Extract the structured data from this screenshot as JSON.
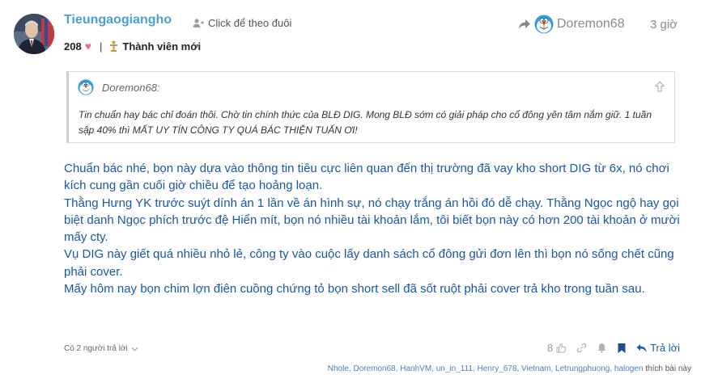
{
  "header": {
    "username": "Tieungaogiangho",
    "follow_label": "Click để theo đuôi",
    "reply_to_user": "Doremon68",
    "time": "3 giờ",
    "points": "208",
    "rank_label": "Thành viên mới"
  },
  "quote": {
    "author": "Doremon68:",
    "text": "Tin chuẩn hay bác chỉ đoán thôi. Chờ tin chính thức của BLĐ DIG. Mong BLĐ sớm có giải pháp cho cổ đông yên tâm nắm giữ. 1 tuần sập 40% thì MẤT UY TÍN CÔNG TY QUÁ BÁC THIỆN TUẤN ƠI!"
  },
  "body": {
    "p1": "Chuẩn bác nhé, bọn này dựa vào thông tin tiêu cực liên quan đến thị trường đã vay kho short DIG từ 6x, nó chơi kích cung gần cuối giờ chiều để tạo hoảng loạn.",
    "p2": "Thằng Hưng YK trước suýt dính án 1 lần về án hình sự, nó chạy trắng án hồi đó dễ chạy. Thằng Ngọc ngộ hay gọi biệt danh Ngọc phích trước đệ Hiển mít, bọn nó nhiều tài khoản lắm, tôi biết bọn này có hơn 200 tài khoản ở mười mấy cty.",
    "p3": "Vụ DIG này giết quá nhiều nhỏ lẻ, công ty vào cuộc lấy danh sách cổ đông gửi đơn lên thì bọn nó sống chết cũng phải cover.",
    "p4": "Mấy hôm nay bọn chim lợn điên cuồng chứng tỏ bọn short sell đã sốt ruột phải cover trả kho trong tuần sau."
  },
  "footer": {
    "replies_label": "Có 2 người trả lời",
    "like_count": "8",
    "reply_label": "Trả lời",
    "liked_by": "Nhole, Doremon68, HanhVM, un_in_111, Henry_678, Vietnam, Letrungphuong, halogen",
    "liked_suffix": "thích bài này"
  },
  "colors": {
    "username": "#4a9fd6",
    "body_text": "#1a57a9",
    "heart": "#f46a8c",
    "reply_button": "#1d5ea8"
  }
}
